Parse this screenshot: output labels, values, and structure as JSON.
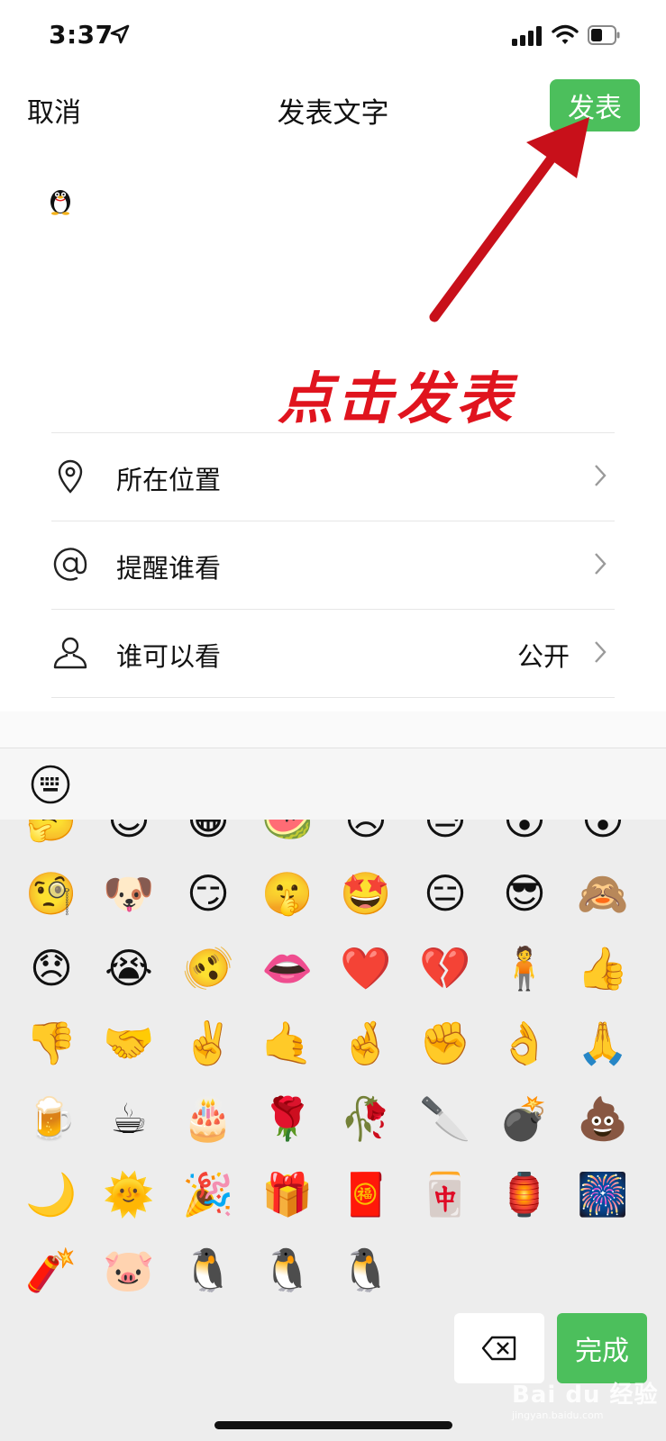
{
  "status": {
    "time": "3:37"
  },
  "nav": {
    "cancel": "取消",
    "title": "发表文字",
    "post": "发表"
  },
  "draft": {
    "emoji": "🐧"
  },
  "annotation": {
    "text": "点击发表"
  },
  "options": [
    {
      "icon": "location-pin-icon",
      "label": "所在位置",
      "value": ""
    },
    {
      "icon": "at-icon",
      "label": "提醒谁看",
      "value": ""
    },
    {
      "icon": "person-icon",
      "label": "谁可以看",
      "value": "公开"
    }
  ],
  "emoji_rows": [
    [
      "🤔",
      "😊",
      "😁",
      "🍉",
      "😠",
      "😓",
      "😲",
      "😮"
    ],
    [
      "🧐",
      "🐶",
      "😏",
      "🤫",
      "🤩",
      "😑",
      "😎",
      "🙈"
    ],
    [
      "😞",
      "😭",
      "🫨",
      "👄",
      "❤️",
      "💔",
      "🧍",
      "👍"
    ],
    [
      "👎",
      "🤝",
      "✌️",
      "🤙",
      "🤞",
      "✊",
      "👌",
      "🙏"
    ],
    [
      "🍺",
      "☕",
      "🎂",
      "🌹",
      "🥀",
      "🔪",
      "💣",
      "💩"
    ],
    [
      "🌙",
      "🌞",
      "🎉",
      "🎁",
      "🧧",
      "🀄",
      "🏮",
      "🎆"
    ],
    [
      "🧨",
      "🐷",
      "🐧",
      "🐧",
      "🐧"
    ]
  ],
  "keyboard": {
    "done": "完成"
  },
  "watermark": {
    "main": "Bai du 经验",
    "sub": "jingyan.baidu.com"
  },
  "colors": {
    "accent_green": "#4cbf5c",
    "annotation_red": "#e0141e"
  }
}
